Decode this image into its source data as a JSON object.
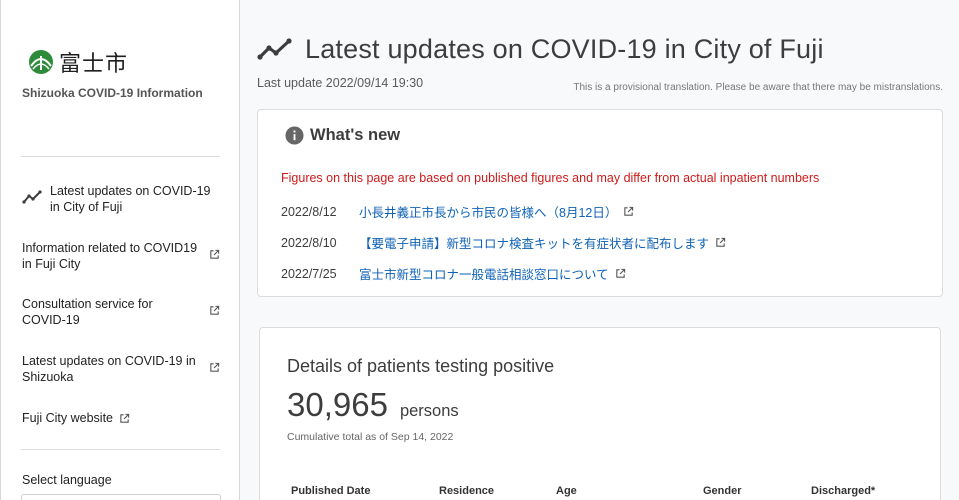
{
  "sidebar": {
    "logo_text": "富士市",
    "site_title": "Shizuoka COVID-19 Information",
    "nav": [
      {
        "label": "Latest updates on COVID-19 in City of Fuji",
        "icon": "chart-line-icon"
      },
      {
        "label": "Information related to COVID19 in Fuji City",
        "icon": "external-link-icon"
      },
      {
        "label": "Consultation service for COVID-19",
        "icon": "external-link-icon"
      },
      {
        "label": "Latest updates on COVID-19 in Shizuoka",
        "icon": "external-link-icon"
      },
      {
        "label": "Fuji City website",
        "icon": "external-link-icon"
      }
    ],
    "language_label": "Select language"
  },
  "header": {
    "title": "Latest updates on COVID-19 in City of Fuji",
    "last_update": "Last update 2022/09/14 19:30",
    "translation_note": "This is a provisional translation. Please be aware that there may be mistranslations."
  },
  "news": {
    "title": "What's new",
    "warning": "Figures on this page are based on published figures and may differ from actual inpatient numbers",
    "items": [
      {
        "date": "2022/8/12",
        "text": "小長井義正市長から市民の皆様へ（8月12日）"
      },
      {
        "date": "2022/8/10",
        "text": "【要電子申請】新型コロナ検査キットを有症状者に配布します"
      },
      {
        "date": "2022/7/25",
        "text": "富士市新型コロナ一般電話相談窓口について"
      }
    ]
  },
  "positives": {
    "title": "Details of patients testing positive",
    "value": "30,965",
    "unit": "persons",
    "note": "Cumulative total as of Sep 14, 2022",
    "columns": [
      "Published Date",
      "Residence",
      "Age",
      "Gender",
      "Discharged*"
    ]
  },
  "colors": {
    "accent_link": "#0f62b6",
    "warning": "#cc1b1b",
    "logo_green": "#2e8b3a"
  }
}
